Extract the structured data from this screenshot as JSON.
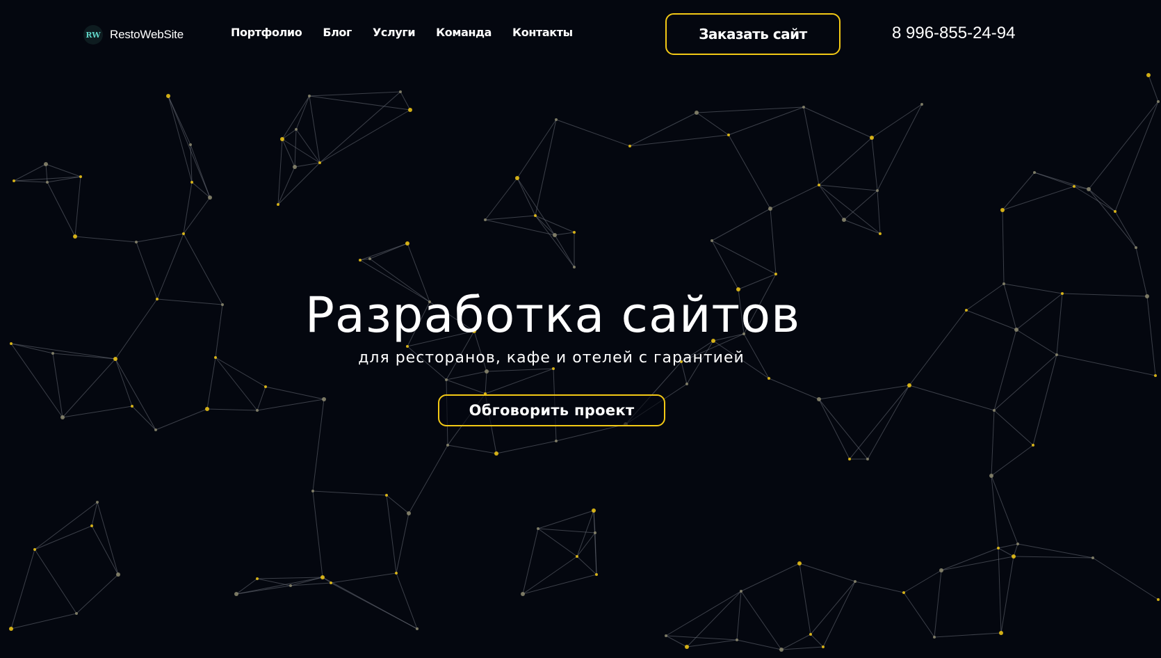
{
  "header": {
    "logo_text": "RestoWebSite",
    "logo_mark": "RW",
    "nav": [
      {
        "label": "Портфолио"
      },
      {
        "label": "Блог"
      },
      {
        "label": "Услуги"
      },
      {
        "label": "Команда"
      },
      {
        "label": "Контакты"
      }
    ],
    "order_button": "Заказать сайт",
    "phone": "8 996-855-24-94"
  },
  "hero": {
    "title": "Разработка сайтов",
    "subtitle": "для ресторанов, кафе и отелей с гарантией",
    "cta_button": "Обговорить проект"
  },
  "colors": {
    "background": "#04070f",
    "accent": "#f3c915",
    "text": "#ffffff",
    "network_lines": "#6b6f7a"
  }
}
